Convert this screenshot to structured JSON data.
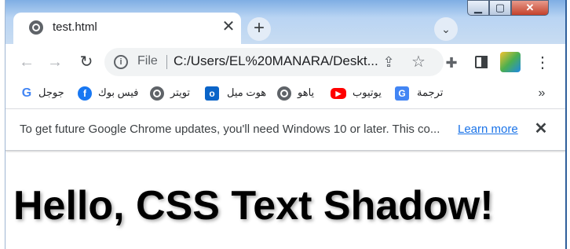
{
  "tab": {
    "title": "test.html",
    "close": "✕"
  },
  "newtab": {
    "label": "+"
  },
  "window": {
    "minimize": "▁",
    "maximize": "▢",
    "close": "✕"
  },
  "toolbar": {
    "file_label": "File",
    "url": "C:/Users/EL%20MANARA/Deskt..."
  },
  "bookmarks": {
    "items": [
      {
        "label": "جوجل",
        "icon": "google-icon"
      },
      {
        "label": "فيس بوك",
        "icon": "facebook-icon"
      },
      {
        "label": "تويتر",
        "icon": "globe-icon"
      },
      {
        "label": "هوت ميل",
        "icon": "outlook-icon"
      },
      {
        "label": "ياهو",
        "icon": "globe-icon"
      },
      {
        "label": "يوتيوب",
        "icon": "youtube-icon"
      },
      {
        "label": "ترجمة",
        "icon": "translate-icon"
      }
    ],
    "more": "»"
  },
  "infobar": {
    "message": "To get future Google Chrome updates, you'll need Windows 10 or later. This co...",
    "link": "Learn more",
    "close": "✕"
  },
  "page": {
    "headline": "Hello, CSS Text Shadow!"
  },
  "colors": {
    "accent": "#1a73e8",
    "titlebar": "#b9d4f3"
  }
}
